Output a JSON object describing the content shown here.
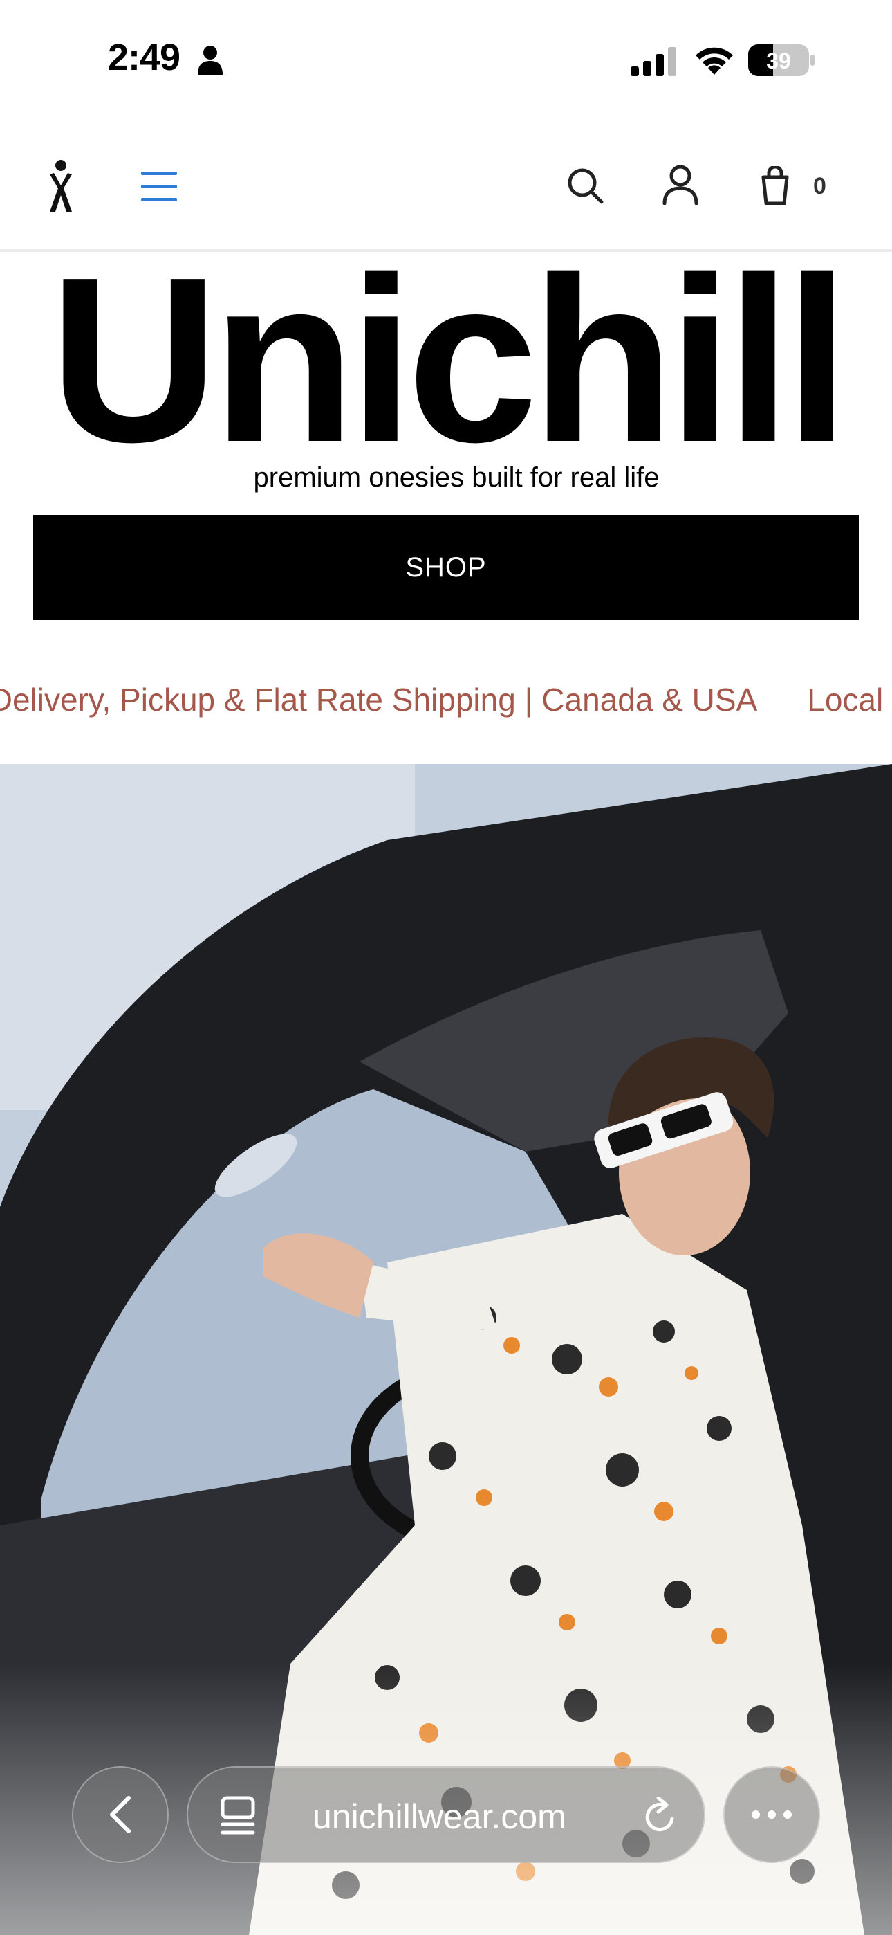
{
  "status_bar": {
    "time": "2:49",
    "battery": "39"
  },
  "header": {
    "cart_count": "0"
  },
  "hero": {
    "brand": "Unichill",
    "tagline": "premium onesies built for real life",
    "shop_label": "SHOP"
  },
  "marquee": {
    "items": [
      "Local Delivery, Pickup & Flat Rate Shipping | Canada & USA",
      "Local"
    ]
  },
  "browser": {
    "url": "unichillwear.com"
  },
  "colors": {
    "menu_accent": "#2f7bd9",
    "marquee_text": "#a5574a",
    "button_bg": "#000000"
  },
  "icons": [
    "person-icon",
    "signal-icon",
    "wifi-icon",
    "battery-icon",
    "logo-icon",
    "hamburger-icon",
    "search-icon",
    "account-icon",
    "cart-icon",
    "chevron-left-icon",
    "tabs-icon",
    "reload-icon",
    "more-icon"
  ]
}
